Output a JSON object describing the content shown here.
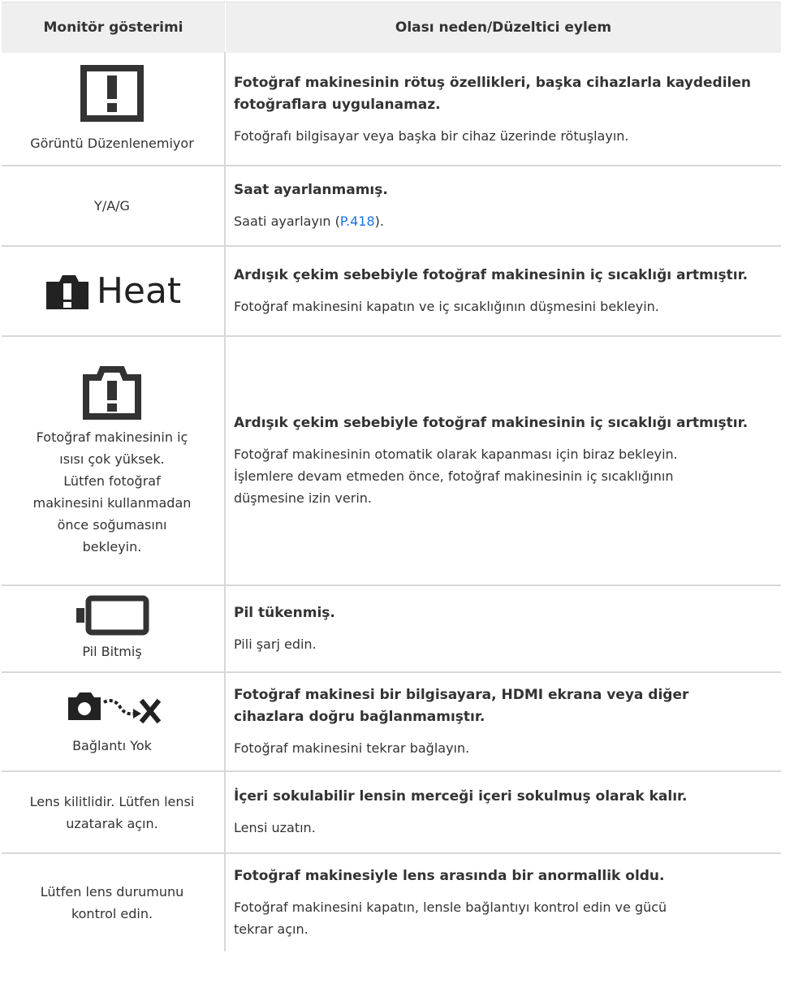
{
  "header": {
    "col1": "Monitör gösterimi",
    "col2": "Olası neden/Düzeltici eylem"
  },
  "rows": [
    {
      "icon": "exclamation-box-icon",
      "label": "Görüntü Düzenlenemiyor",
      "title": "Fotoğraf makinesinin rötuş özellikleri, başka cihazlarla kaydedilen fotoğraflara uygulanamaz.",
      "desc": "Fotoğrafı bilgisayar veya başka bir cihaz üzerinde rötuşlayın."
    },
    {
      "label": "Y/A/G",
      "title": "Saat ayarlanmamış.",
      "desc_pre": "Saati ayarlayın (",
      "desc_link": "P.418",
      "desc_post": ")."
    },
    {
      "icon": "camera-heat-icon",
      "icon_text": "Heat",
      "title": "Ardışık çekim sebebiyle fotoğraf makinesinin iç sıcaklığı artmıştır.",
      "desc": "Fotoğraf makinesini kapatın ve iç sıcaklığının düşmesini bekleyin."
    },
    {
      "icon": "camera-warning-outline-icon",
      "label_lines": [
        "Fotoğraf makinesinin iç",
        "ısısı çok yüksek.",
        "Lütfen fotoğraf",
        "makinesini kullanmadan",
        "önce soğumasını",
        "bekleyin."
      ],
      "title": "Ardışık çekim sebebiyle fotoğraf makinesinin iç sıcaklığı artmıştır.",
      "desc_lines": [
        "Fotoğraf makinesinin otomatik olarak kapanması için biraz bekleyin.",
        "İşlemlere devam etmeden önce, fotoğraf makinesinin iç sıcaklığının",
        "düşmesine izin verin."
      ]
    },
    {
      "icon": "battery-empty-icon",
      "label": "Pil Bitmiş",
      "title": "Pil tükenmiş.",
      "desc": "Pili şarj edin."
    },
    {
      "icon": "camera-disconnected-icon",
      "label": "Bağlantı Yok",
      "title_lines": [
        "Fotoğraf makinesi bir bilgisayara, HDMI ekrana veya diğer",
        "cihazlara doğru bağlanmamıştır."
      ],
      "desc": "Fotoğraf makinesini tekrar bağlayın."
    },
    {
      "label_lines": [
        "Lens kilitlidir. Lütfen lensi",
        "uzatarak açın."
      ],
      "title": "İçeri sokulabilir lensin merceği içeri sokulmuş olarak kalır.",
      "desc": "Lensi uzatın."
    },
    {
      "label_lines": [
        "Lütfen lens durumunu",
        "kontrol edin."
      ],
      "title": "Fotoğraf makinesiyle lens arasında bir anormallik oldu.",
      "desc_lines": [
        "Fotoğraf makinesini kapatın, lensle bağlantıyı kontrol edin ve gücü",
        "tekrar açın."
      ]
    }
  ]
}
